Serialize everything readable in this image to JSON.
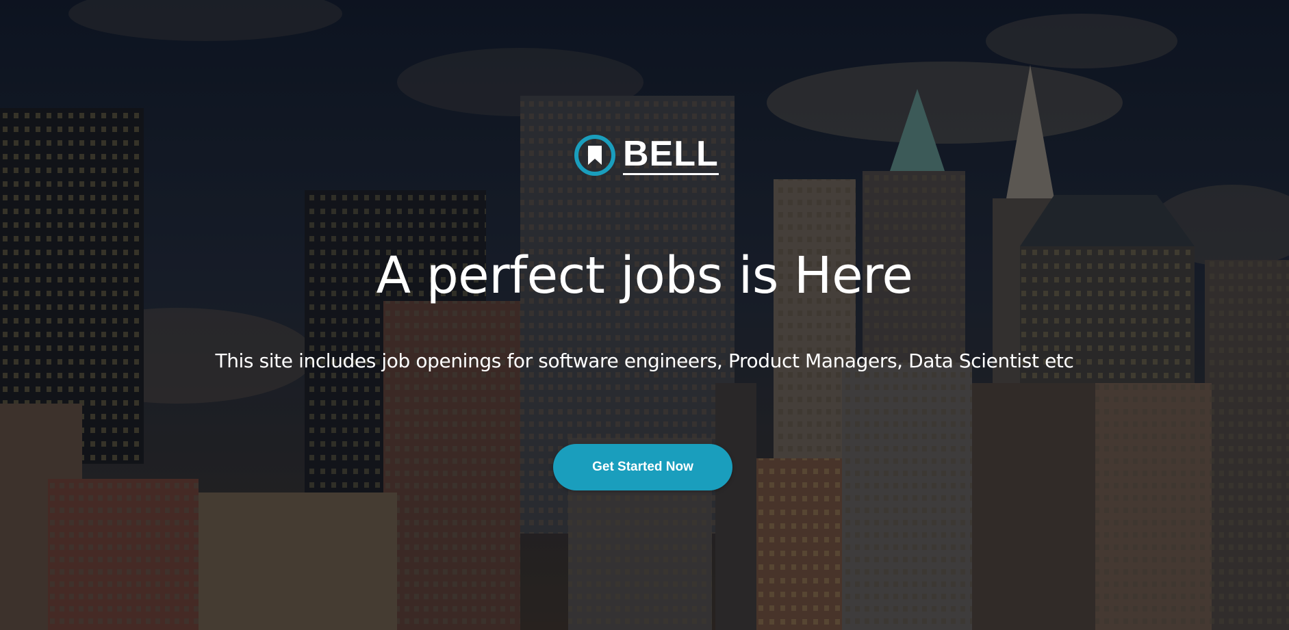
{
  "brand": {
    "name": "BELL",
    "logo_icon": "bookmark-circle-icon",
    "accent_color": "#1a9ebd"
  },
  "hero": {
    "headline": "A perfect jobs is Here",
    "subtitle": "This site includes job openings for software engineers, Product Managers, Data Scientist etc",
    "cta_label": "Get Started Now",
    "background": "city-skyline-photo"
  }
}
